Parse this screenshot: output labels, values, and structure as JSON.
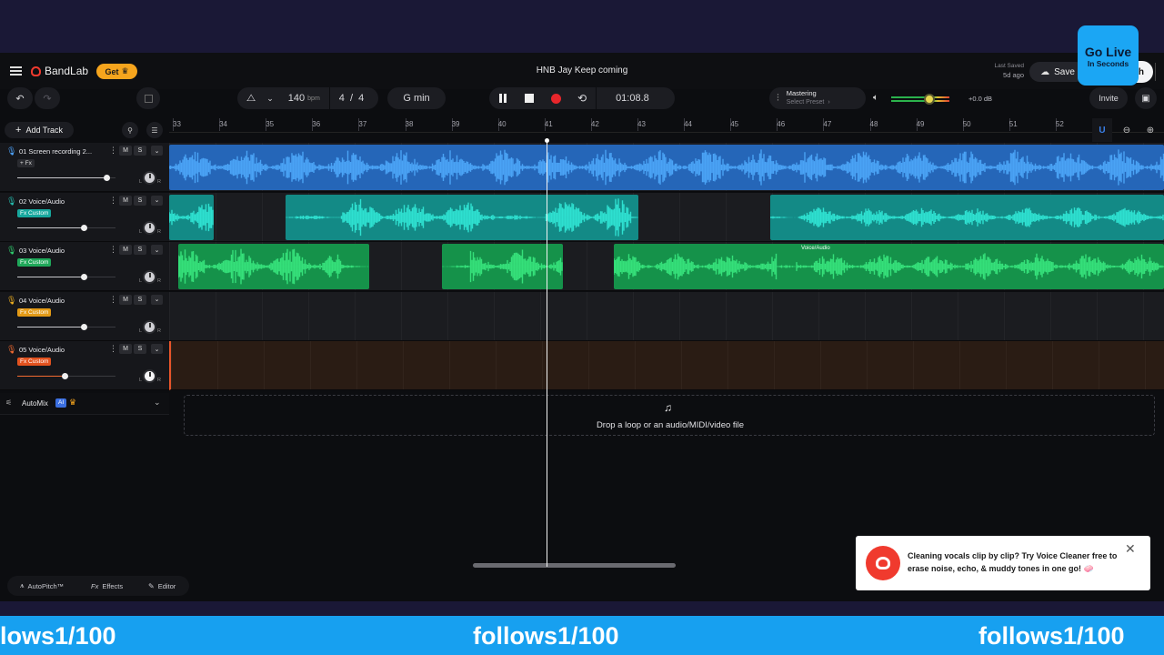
{
  "app": {
    "brand": "BandLab",
    "get_label": "Get",
    "project_title": "HNB Jay Keep coming",
    "last_saved_label": "Last Saved",
    "last_saved_value": "5d ago",
    "save_label": "Save",
    "publish_partial": "h",
    "invite_label": "Invite"
  },
  "go_live": {
    "title": "Go Live",
    "subtitle": "In Seconds"
  },
  "transport": {
    "bpm": "140",
    "bpm_unit": "bpm",
    "time_sig_top": "4",
    "time_sig_sep": "/",
    "time_sig_bottom": "4",
    "key": "G min",
    "time": "01:08.8"
  },
  "mastering": {
    "title": "Mastering",
    "subtitle": "Select Preset",
    "chevron": "›"
  },
  "master_volume": {
    "db": "+0.0 dB",
    "level": 0.65
  },
  "add_track_label": "Add Track",
  "ruler": {
    "bars": [
      "33",
      "34",
      "35",
      "36",
      "37",
      "38",
      "39",
      "40",
      "41",
      "42",
      "43",
      "44",
      "45",
      "46",
      "47",
      "48",
      "49",
      "50",
      "51",
      "52"
    ]
  },
  "tracks": [
    {
      "name": "01  Screen recording 2...",
      "fx": "+ Fx",
      "fx_style": "plain",
      "volume": 0.91,
      "color": "#3a8fe6",
      "mic_color": "#4ea5ff"
    },
    {
      "name": "02  Voice/Audio",
      "fx": "Fx Custom",
      "fx_style": "teal",
      "volume": 0.68,
      "color": "#1fb8b0",
      "mic_color": "#25c0b2"
    },
    {
      "name": "03  Voice/Audio",
      "fx": "Fx Custom",
      "fx_style": "green",
      "volume": 0.68,
      "color": "#1fb05a",
      "mic_color": "#2fcf6e"
    },
    {
      "name": "04  Voice/Audio",
      "fx": "Fx Custom",
      "fx_style": "orange",
      "volume": 0.68,
      "color": "#e3a41a",
      "mic_color": "#f0b020"
    },
    {
      "name": "05  Voice/Audio",
      "fx": "Fx Custom",
      "fx_style": "red",
      "volume": 0.48,
      "color": "#e8552a",
      "mic_color": "#f26a30"
    }
  ],
  "clip_labels": {
    "track3_last": "Voice/Audio"
  },
  "automix": {
    "label": "AutoMix",
    "ai_badge": "AI"
  },
  "drop_zone": {
    "text": "Drop a loop or an audio/MIDI/video file"
  },
  "bottom_tools": {
    "autopitch": "AutoPitch™",
    "effects": "Effects",
    "editor": "Editor",
    "fx_prefix": "Fx"
  },
  "toast": {
    "message": "Cleaning vocals clip by clip? Try Voice Cleaner free to erase noise, echo, & muddy tones in one go! 🧼"
  },
  "footer_banner": {
    "items": [
      "lows1/100",
      "follows1/100",
      "follows1/100"
    ]
  },
  "colors": {
    "accent_orange": "#f6a51d",
    "brand_red": "#f03a2e",
    "record_red": "#e8262b",
    "go_live_blue": "#1ba6f4"
  },
  "icons": [
    "menu-icon",
    "bandlab-logo-icon",
    "crown-icon",
    "undo-icon",
    "redo-icon",
    "metronome-icon",
    "chevron-down-icon",
    "pause-icon",
    "stop-icon",
    "record-icon",
    "loop-icon",
    "mixer-icon",
    "speaker-icon",
    "cloud-upload-icon",
    "gift-icon",
    "magnet-icon",
    "zoom-out-icon",
    "zoom-in-icon",
    "mic-icon",
    "add-music-icon",
    "close-icon"
  ]
}
